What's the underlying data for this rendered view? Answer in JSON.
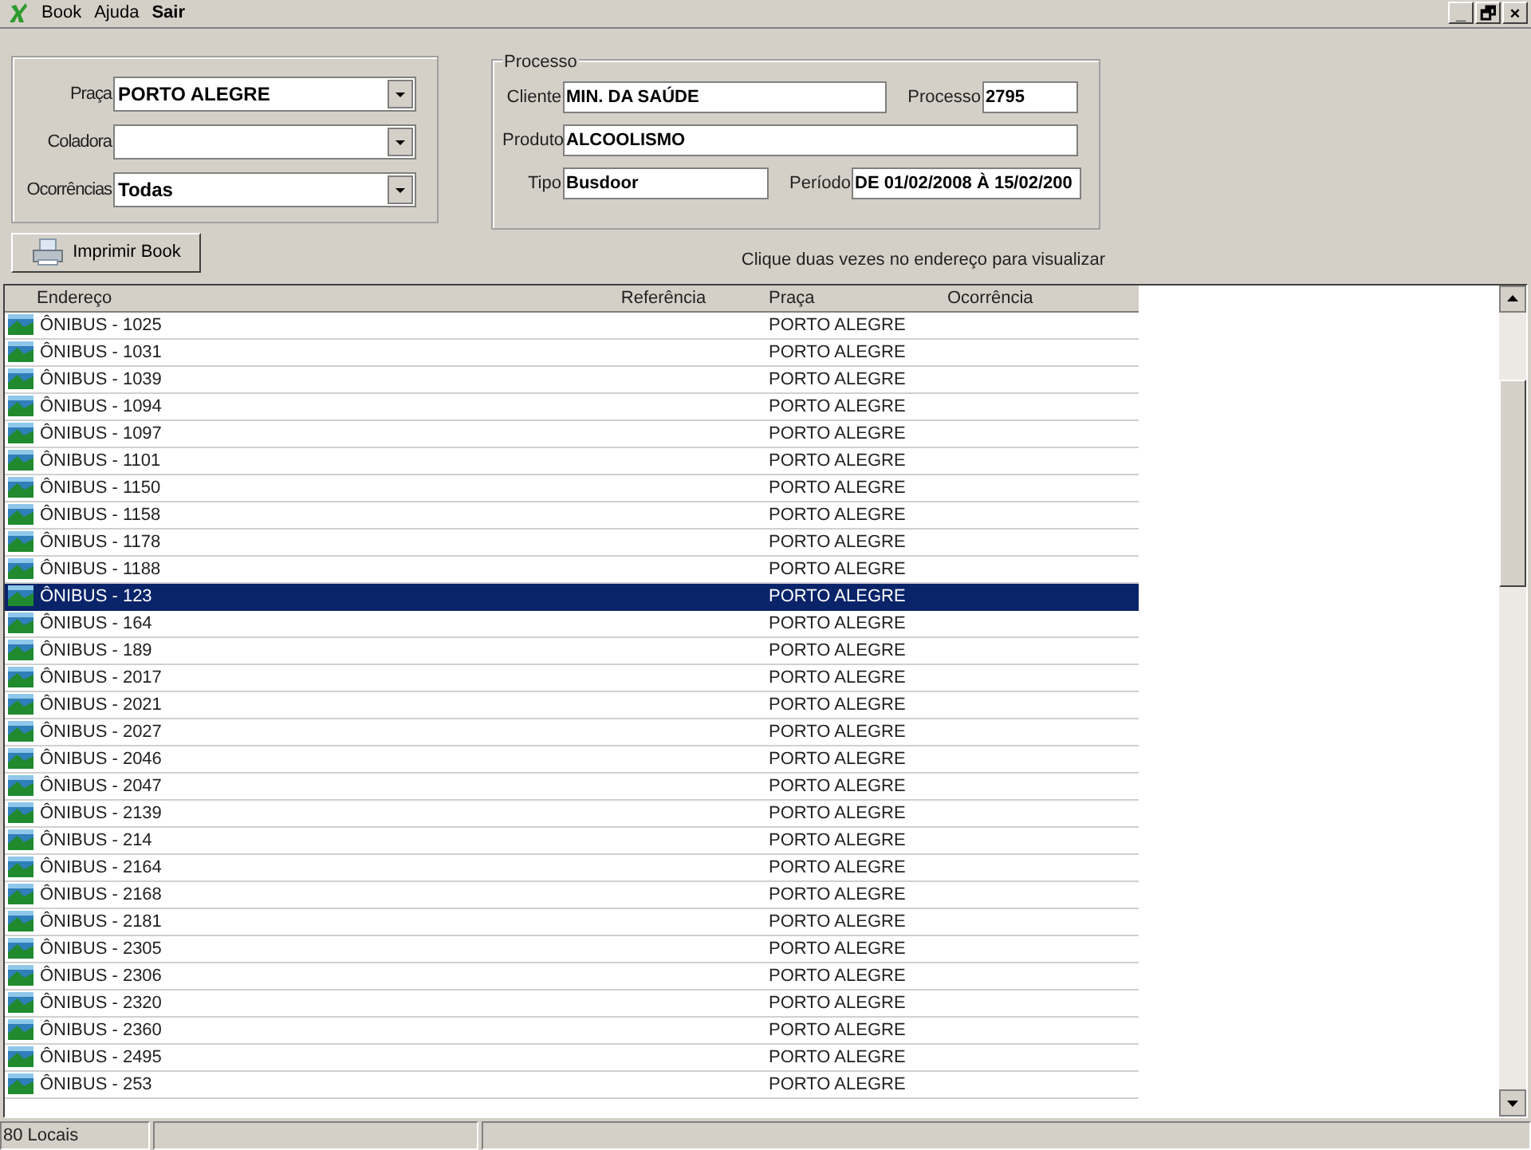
{
  "menu": [
    {
      "label": "Book",
      "bold": false
    },
    {
      "label": "Ajuda",
      "bold": false
    },
    {
      "label": "Sair",
      "bold": true
    }
  ],
  "window_controls": [
    "_",
    "🗗",
    "×"
  ],
  "filters": [
    {
      "label": "Praça",
      "value": "PORTO ALEGRE"
    },
    {
      "label": "Coladora"
    },
    {
      "label": "Ocorrências",
      "value": "Todas"
    }
  ],
  "processo": {
    "title": "Processo",
    "cliente": {
      "label": "Cliente",
      "value": "MIN. DA SAÚDE"
    },
    "processo": {
      "label": "Processo",
      "value": "2795"
    },
    "produto": {
      "label": "Produto",
      "value": "ALCOOLISMO"
    },
    "tipo": {
      "label": "Tipo",
      "value": "Busdoor"
    },
    "periodo": {
      "label": "Período",
      "value": "DE 01/02/2008 À 15/02/200"
    }
  },
  "print_button": "Imprimir Book",
  "hint": "Clique duas vezes no endereço para visualizar",
  "table": {
    "columns": [
      "Endereço",
      "Referência",
      "Praça",
      "Ocorrência"
    ],
    "rows": [
      {
        "endereco": "ÔNIBUS - 1025",
        "praca": "PORTO ALEGRE",
        "selected": false
      },
      {
        "endereco": "ÔNIBUS - 1031",
        "praca": "PORTO ALEGRE",
        "selected": false
      },
      {
        "endereco": "ÔNIBUS - 1039",
        "praca": "PORTO ALEGRE",
        "selected": false
      },
      {
        "endereco": "ÔNIBUS - 1094",
        "praca": "PORTO ALEGRE",
        "selected": false
      },
      {
        "endereco": "ÔNIBUS - 1097",
        "praca": "PORTO ALEGRE",
        "selected": false
      },
      {
        "endereco": "ÔNIBUS - 1101",
        "praca": "PORTO ALEGRE",
        "selected": false
      },
      {
        "endereco": "ÔNIBUS - 1150",
        "praca": "PORTO ALEGRE",
        "selected": false
      },
      {
        "endereco": "ÔNIBUS - 1158",
        "praca": "PORTO ALEGRE",
        "selected": false
      },
      {
        "endereco": "ÔNIBUS - 1178",
        "praca": "PORTO ALEGRE",
        "selected": false
      },
      {
        "endereco": "ÔNIBUS - 1188",
        "praca": "PORTO ALEGRE",
        "selected": false
      },
      {
        "endereco": "ÔNIBUS - 123",
        "praca": "PORTO ALEGRE",
        "selected": true
      },
      {
        "endereco": "ÔNIBUS - 164",
        "praca": "PORTO ALEGRE",
        "selected": false
      },
      {
        "endereco": "ÔNIBUS - 189",
        "praca": "PORTO ALEGRE",
        "selected": false
      },
      {
        "endereco": "ÔNIBUS - 2017",
        "praca": "PORTO ALEGRE",
        "selected": false
      },
      {
        "endereco": "ÔNIBUS - 2021",
        "praca": "PORTO ALEGRE",
        "selected": false
      },
      {
        "endereco": "ÔNIBUS - 2027",
        "praca": "PORTO ALEGRE",
        "selected": false
      },
      {
        "endereco": "ÔNIBUS - 2046",
        "praca": "PORTO ALEGRE",
        "selected": false
      },
      {
        "endereco": "ÔNIBUS - 2047",
        "praca": "PORTO ALEGRE",
        "selected": false
      },
      {
        "endereco": "ÔNIBUS - 2139",
        "praca": "PORTO ALEGRE",
        "selected": false
      },
      {
        "endereco": "ÔNIBUS - 214",
        "praca": "PORTO ALEGRE",
        "selected": false
      },
      {
        "endereco": "ÔNIBUS - 2164",
        "praca": "PORTO ALEGRE",
        "selected": false
      },
      {
        "endereco": "ÔNIBUS - 2168",
        "praca": "PORTO ALEGRE",
        "selected": false
      },
      {
        "endereco": "ÔNIBUS - 2181",
        "praca": "PORTO ALEGRE",
        "selected": false
      },
      {
        "endereco": "ÔNIBUS - 2305",
        "praca": "PORTO ALEGRE",
        "selected": false
      },
      {
        "endereco": "ÔNIBUS - 2306",
        "praca": "PORTO ALEGRE",
        "selected": false
      },
      {
        "endereco": "ÔNIBUS - 2320",
        "praca": "PORTO ALEGRE",
        "selected": false
      },
      {
        "endereco": "ÔNIBUS - 2360",
        "praca": "PORTO ALEGRE",
        "selected": false
      },
      {
        "endereco": "ÔNIBUS - 2495",
        "praca": "PORTO ALEGRE",
        "selected": false
      },
      {
        "endereco": "ÔNIBUS - 253",
        "praca": "PORTO ALEGRE",
        "selected": false
      }
    ]
  },
  "status_bar": [
    "80 Locais"
  ]
}
